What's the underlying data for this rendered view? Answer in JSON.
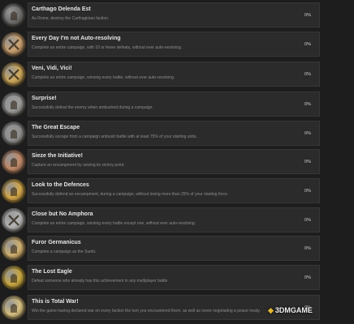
{
  "achievements": [
    {
      "title": "Carthago Delenda Est",
      "description": "As Rome, destroy the Carthaginian faction.",
      "percent": "0%",
      "badge": "helmet-badge-icon",
      "color": "#6d6d6d"
    },
    {
      "title": "Every Day I'm not Auto-resolving",
      "description": "Complete an entire campaign, with 10 or fewer defeats, without ever auto-resolving.",
      "percent": "0%",
      "badge": "crossed-swords-badge-icon",
      "color": "#c9a070"
    },
    {
      "title": "Veni, Vidi, Vici!",
      "description": "Complete an entire campaign, winning every battle, without ever auto-resolving.",
      "percent": "0%",
      "badge": "crossed-swords-badge-icon",
      "color": "#cda85a"
    },
    {
      "title": "Surprise!",
      "description": "Successfully defeat the enemy when ambushed during a campaign.",
      "percent": "0%",
      "badge": "soldier-badge-icon",
      "color": "#9a9a9a"
    },
    {
      "title": "The Great Escape",
      "description": "Successfully escape from a campaign ambush battle with at least 75% of your starting units.",
      "percent": "0%",
      "badge": "fortress-badge-icon",
      "color": "#8f8f8f"
    },
    {
      "title": "Sieze the Initiative!",
      "description": "Capture an encampment by seizing its victory point.",
      "percent": "0%",
      "badge": "warrior-badge-icon",
      "color": "#c08a6a"
    },
    {
      "title": "Look to the Defences",
      "description": "Successfully defend an encampment, during a campaign, without losing more than 25% of your starting force.",
      "percent": "0%",
      "badge": "gate-badge-icon",
      "color": "#d4a84a"
    },
    {
      "title": "Close but No Amphora",
      "description": "Complete an entire campaign, winning every battle except one, without ever auto-resolving.",
      "percent": "0%",
      "badge": "crossed-swords-badge-icon",
      "color": "#b5b5b5"
    },
    {
      "title": "Furor Germanicus",
      "description": "Complete a campaign as the Suebi.",
      "percent": "0%",
      "badge": "shield-badge-icon",
      "color": "#d0b070"
    },
    {
      "title": "The Lost Eagle",
      "description": "Defeat someone who already has this achievement in any multiplayer battle.",
      "percent": "0%",
      "badge": "eagle-badge-icon",
      "color": "#c9a840"
    },
    {
      "title": "This is Total War!",
      "description": "Win the game having declared war on every faction the turn you encountered them, as well as never negotiating a peace treaty.",
      "percent": "0%",
      "badge": "helmet-badge-icon",
      "color": "#d6c080"
    }
  ],
  "watermark": {
    "icon": "3dm-logo-icon",
    "text": "3DMGAME"
  }
}
